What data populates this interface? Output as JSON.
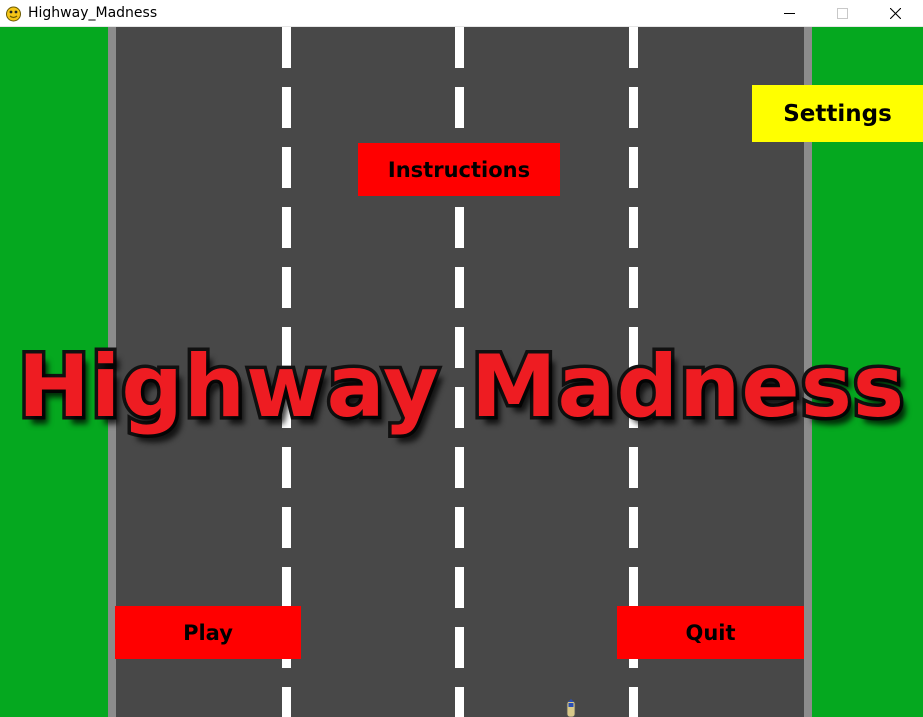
{
  "window": {
    "title": "Highway_Madness",
    "icon": "pygame-snake-icon",
    "controls": {
      "minimize": "minimize-icon",
      "maximize": "maximize-icon",
      "close": "close-icon"
    }
  },
  "game": {
    "title": "Highway Madness",
    "buttons": {
      "settings": "Settings",
      "instructions": "Instructions",
      "play": "Play",
      "quit": "Quit"
    }
  },
  "colors": {
    "grass": "#05a81f",
    "road": "#484848",
    "road_edge": "#8c8c8c",
    "lane_marking": "#ffffff",
    "primary_button": "#ff0000",
    "settings_button": "#ffff00",
    "title_fill": "#ee1c22",
    "title_outline": "#111111"
  }
}
